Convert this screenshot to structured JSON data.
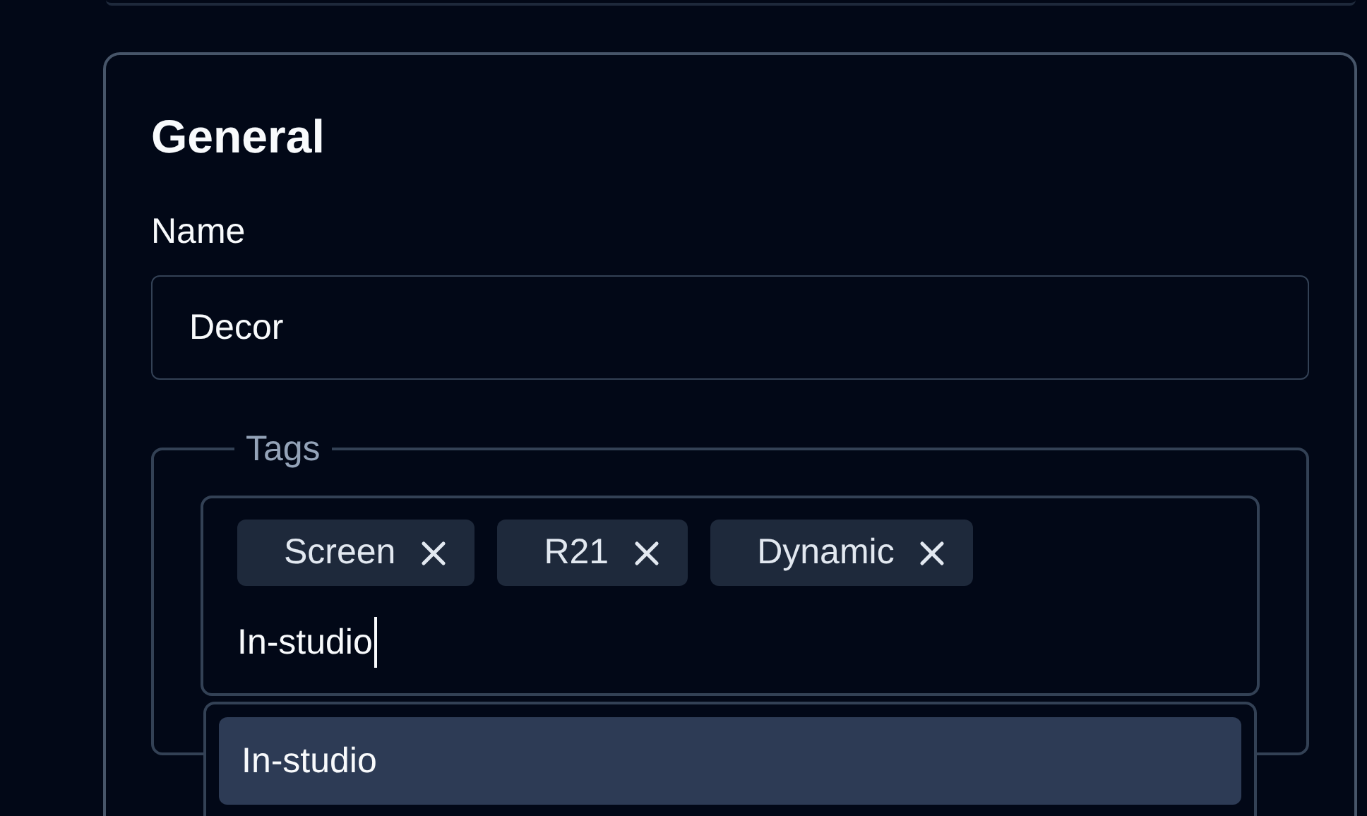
{
  "section": {
    "title": "General"
  },
  "name_field": {
    "label": "Name",
    "value": "Decor"
  },
  "tags": {
    "legend": "Tags",
    "chips": [
      {
        "label": "Screen"
      },
      {
        "label": "R21"
      },
      {
        "label": "Dynamic"
      }
    ],
    "input_value": "In-studio",
    "suggestions": [
      {
        "label": "In-studio",
        "selected": true
      }
    ]
  }
}
